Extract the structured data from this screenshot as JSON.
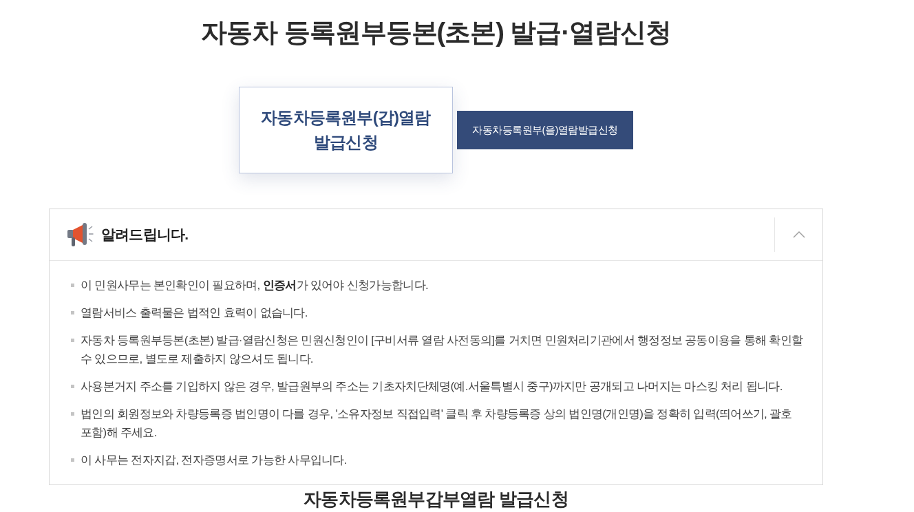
{
  "page": {
    "title": "자동차 등록원부등본(초본) 발급·열람신청"
  },
  "tabs": [
    {
      "label": "자동차등록원부(갑)열람 발급신청",
      "selected": true
    },
    {
      "label": "자동차등록원부(을)열람발급신청",
      "selected": false
    }
  ],
  "notice": {
    "title": "알려드립니다.",
    "expanded": true,
    "items": [
      "이 민원사무는 본인확인이 필요하며, **인증서**가 있어야 신청가능합니다.",
      "열람서비스 출력물은 법적인 효력이 없습니다.",
      "자동차 등록원부등본(초본) 발급·열람신청은 민원신청인이 [구비서류 열람 사전동의]를 거치면 민원처리기관에서 행정정보 공동이용을 통해 확인할 수 있으므로, 별도로 제출하지 않으셔도 됩니다.",
      "사용본거지 주소를 기입하지 않은 경우, 발급원부의 주소는 기초자치단체명(예.서울특별시 중구)까지만 공개되고 나머지는 마스킹 처리 됩니다.",
      "법인의 회원정보와 차량등록증 법인명이 다를 경우, '소유자정보 직접입력' 클릭 후 차량등록증 상의 법인명(개인명)을 정확히 입력(띄어쓰기, 괄호 포함)해 주세요.",
      "이 사무는 전자지갑, 전자증명서로 가능한 사무입니다."
    ]
  },
  "section": {
    "title": "자동차등록원부갑부열람 발급신청"
  }
}
